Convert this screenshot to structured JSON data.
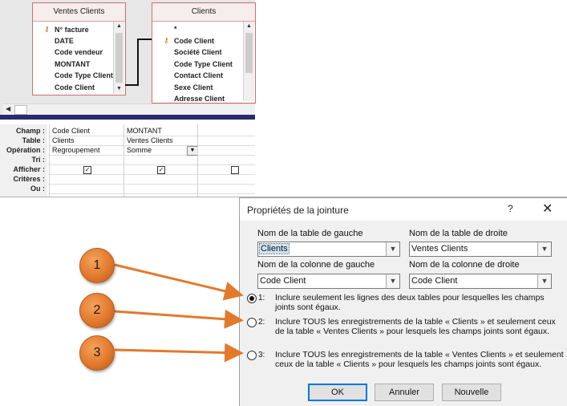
{
  "designer": {
    "table_left": {
      "title": "Ventes Clients",
      "fields": [
        "N° facture",
        "DATE",
        "Code vendeur",
        "MONTANT",
        "Code Type Client",
        "Code Client"
      ]
    },
    "table_right": {
      "title": "Clients",
      "fields": [
        "*",
        "Code Client",
        "Société Client",
        "Code Type Client",
        "Contact Client",
        "Sexe Client",
        "Adresse Client"
      ]
    },
    "grid": {
      "labels": [
        "Champ :",
        "Table :",
        "Opération :",
        "Tri :",
        "Afficher :",
        "Critères :",
        "Ou :"
      ],
      "col1": {
        "champ": "Code Client",
        "table": "Clients",
        "operation": "Regroupement",
        "show": true
      },
      "col2": {
        "champ": "MONTANT",
        "table": "Ventes Clients",
        "operation": "Somme",
        "show": true
      },
      "col3": {
        "show": false
      }
    }
  },
  "dialog": {
    "title": "Propriétés de la jointure",
    "help": "?",
    "close": "✕",
    "left_table_label": "Nom de la table de gauche",
    "right_table_label": "Nom de la table de droite",
    "left_table_value": "Clients",
    "right_table_value": "Ventes Clients",
    "left_col_label": "Nom de la colonne de gauche",
    "right_col_label": "Nom de la colonne de droite",
    "left_col_value": "Code Client",
    "right_col_value": "Code Client",
    "options": [
      {
        "num": "1:",
        "text": "Inclure seulement les lignes des deux tables pour lesquelles les champs joints sont égaux.",
        "selected": true
      },
      {
        "num": "2:",
        "text": "Inclure TOUS les enregistrements de la table « Clients » et seulement ceux de la table « Ventes Clients » pour lesquels les champs joints sont égaux.",
        "selected": false
      },
      {
        "num": "3:",
        "text": "Inclure TOUS les enregistrements de la table « Ventes Clients » et seulement ceux de la table « Clients » pour lesquels les champs joints sont égaux.",
        "selected": false
      }
    ],
    "ok": "OK",
    "cancel": "Annuler",
    "new": "Nouvelle"
  },
  "annotations": [
    "1",
    "2",
    "3"
  ],
  "colors": {
    "bubble": "#e27a2c",
    "arrow": "#e27a2c",
    "table_border": "#cd6f6f"
  }
}
